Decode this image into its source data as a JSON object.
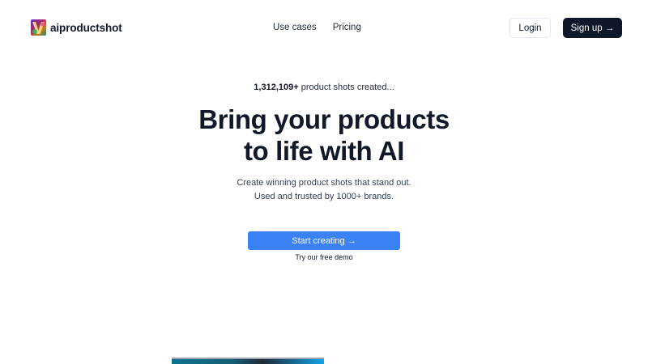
{
  "brand": {
    "name": "aiproductshot"
  },
  "nav": {
    "items": [
      "Use cases",
      "Pricing"
    ],
    "login": "Login",
    "signup": "Sign up →"
  },
  "hero": {
    "counter_value": "1,312,109+",
    "counter_text": " product shots created...",
    "headline_line1": "Bring your products",
    "headline_line2": "to life with AI",
    "subtext_line1": "Create winning product shots that stand out.",
    "subtext_line2": "Used and trusted by 1000+ brands.",
    "cta": "Start creating →",
    "demo_link": "Try our free demo"
  },
  "colors": {
    "primary": "#3b82f6",
    "dark": "#0f172a",
    "text": "#111827"
  }
}
